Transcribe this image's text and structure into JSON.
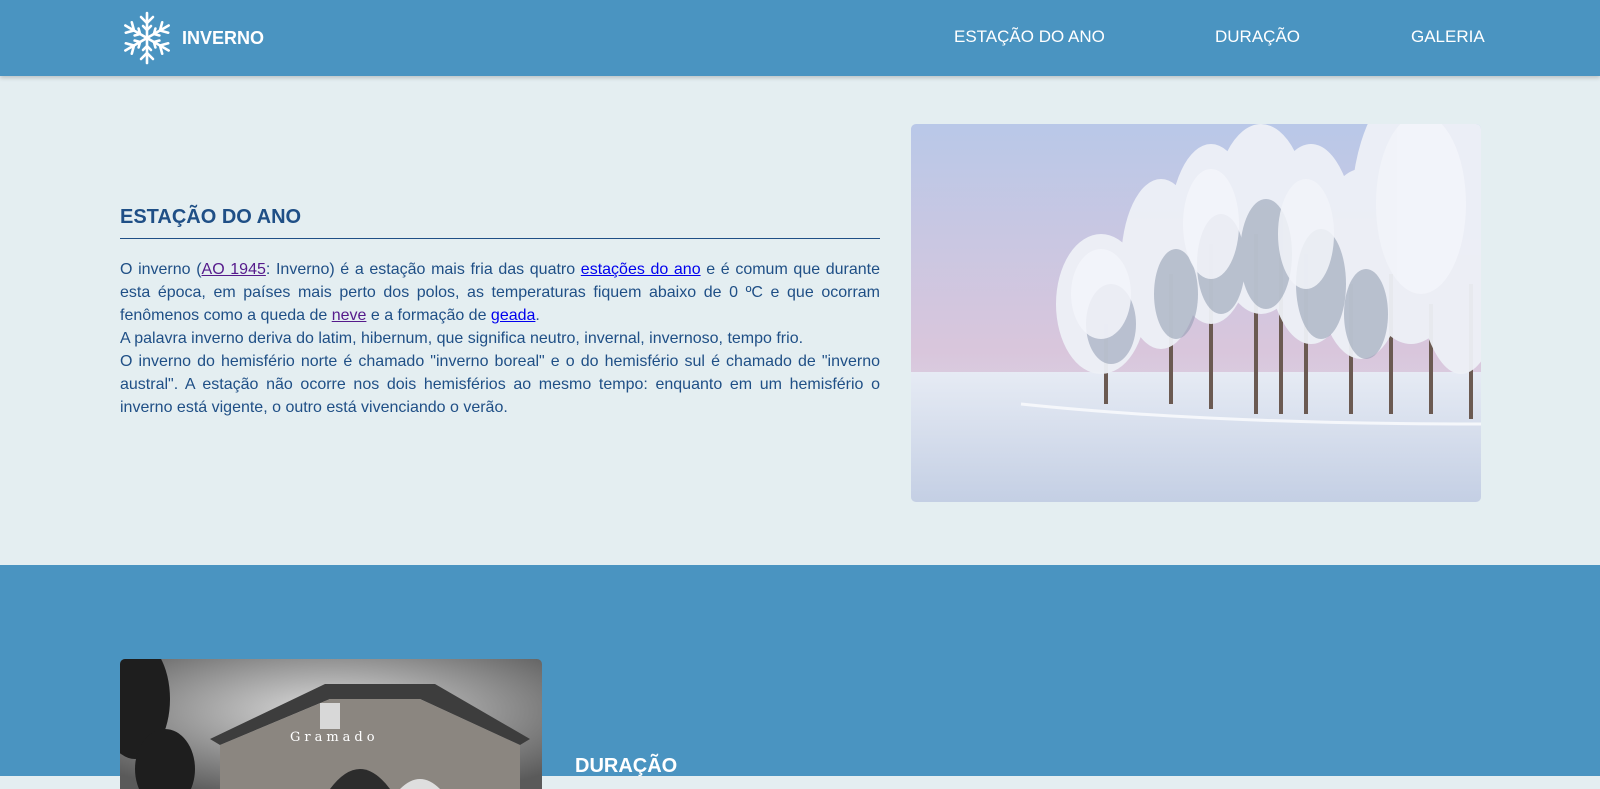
{
  "header": {
    "brand": "INVERNO",
    "logo_icon": "snowflake-icon",
    "nav": [
      {
        "label": "ESTAÇÃO DO ANO"
      },
      {
        "label": "DURAÇÃO"
      },
      {
        "label": "GALERIA"
      }
    ]
  },
  "section_estacao": {
    "title": "ESTAÇÃO DO ANO",
    "p1": {
      "t1": "O inverno (",
      "link_ao": "AO 1945",
      "t2": ": Inverno) é a estação mais fria das quatro ",
      "link_estacoes": "estações do ano",
      "t3": " e é comum que durante esta época, em países mais perto dos polos, as temperaturas fiquem abaixo de 0 ºC e que ocorram fenômenos como a queda de ",
      "link_neve": "neve",
      "t4": " e a formação de ",
      "link_geada": "geada",
      "t5": "."
    },
    "p2": "A palavra inverno deriva do latim, hibernum, que significa neutro, invernal, invernoso, tempo frio.",
    "p3": "O inverno do hemisfério norte é chamado \"inverno boreal\" e o do hemisfério sul é chamado de \"inverno austral\". A estação não ocorre nos dois hemisférios ao mesmo tempo: enquanto em um hemisfério o inverno está vigente, o outro está vivenciando o verão."
  },
  "section_duracao": {
    "title": "DURAÇÃO",
    "photo_sign_text": "Gramado"
  },
  "colors": {
    "primary": "#4a94c1",
    "background": "#e4eef1",
    "text": "#1f4f86"
  }
}
